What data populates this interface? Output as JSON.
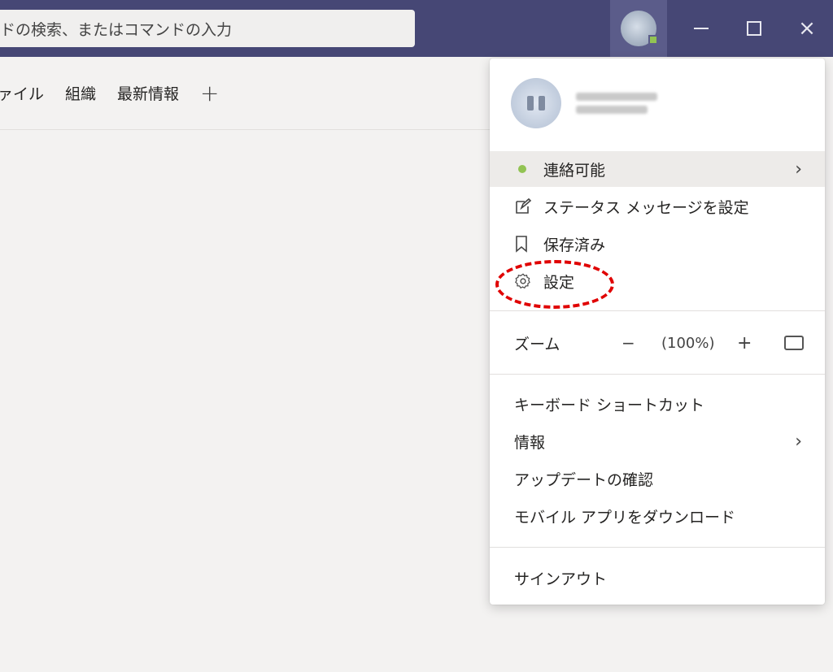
{
  "search": {
    "text": "ドの検索、またはコマンドの入力"
  },
  "tabs": [
    {
      "label": "ァイル"
    },
    {
      "label": "組織"
    },
    {
      "label": "最新情報"
    }
  ],
  "tab_add_label": "+",
  "window": {
    "close": "×"
  },
  "menu": {
    "status": "連絡可能",
    "status_message": "ステータス メッセージを設定",
    "saved": "保存済み",
    "settings": "設定",
    "zoom_label": "ズーム",
    "zoom_minus": "−",
    "zoom_value": "(100%)",
    "zoom_plus": "+",
    "keyboard_shortcuts": "キーボード ショートカット",
    "about": "情報",
    "check_updates": "アップデートの確認",
    "mobile_app": "モバイル アプリをダウンロード",
    "sign_out": "サインアウト",
    "chevron": "›"
  },
  "colors": {
    "titlebar": "#464775",
    "presence": "#92c353",
    "annotation": "#e00000"
  }
}
